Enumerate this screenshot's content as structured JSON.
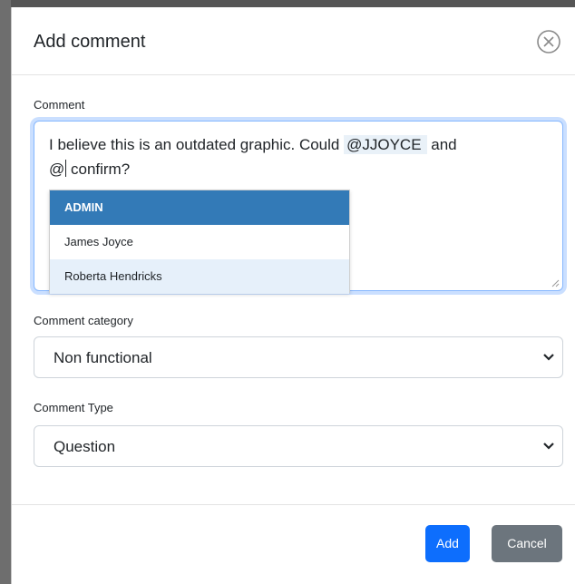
{
  "dialog": {
    "title": "Add comment",
    "comment_label": "Comment",
    "comment_text_before": "I believe this is an outdated graphic. Could ",
    "comment_mention": "@JJOYCE",
    "comment_text_middle": " and",
    "comment_text_at": "@",
    "comment_text_after": " confirm?",
    "mention_suggestions": [
      {
        "label": "ADMIN",
        "state": "active"
      },
      {
        "label": "James Joyce",
        "state": "normal"
      },
      {
        "label": "Roberta Hendricks",
        "state": "hover"
      }
    ],
    "category_label": "Comment category",
    "category_value": "Non functional",
    "type_label": "Comment Type",
    "type_value": "Question",
    "add_button": "Add",
    "cancel_button": "Cancel"
  },
  "colors": {
    "primary": "#0d6efd",
    "secondary": "#6c757d",
    "dropdown_active": "#337ab7",
    "dropdown_hover": "#e6f0fa",
    "focus_border": "#86b7fe"
  }
}
